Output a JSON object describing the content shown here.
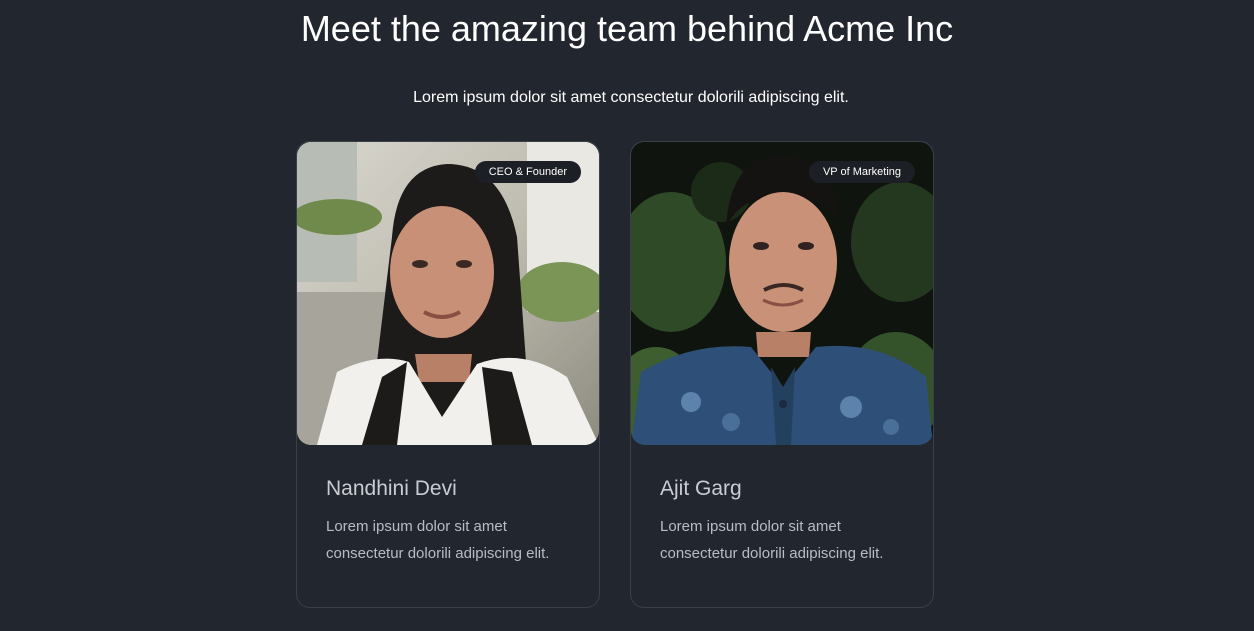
{
  "heading": {
    "title": "Meet the amazing team behind Acme Inc",
    "subtitle": "Lorem ipsum dolor sit amet consectetur dolorili adipiscing elit."
  },
  "team": [
    {
      "role": "CEO & Founder",
      "name": "Nandhini Devi",
      "bio": "Lorem ipsum dolor sit amet consectetur dolorili adipiscing elit.",
      "photo_icon": "portrait-photo"
    },
    {
      "role": "VP of Marketing",
      "name": "Ajit Garg",
      "bio": "Lorem ipsum dolor sit amet consectetur dolorili adipiscing elit.",
      "photo_icon": "portrait-photo"
    }
  ],
  "colors": {
    "background": "#22262e",
    "card_border": "#3a3f48",
    "badge_background": "#1c1f25",
    "text_primary": "#ffffff",
    "text_muted": "#b9bcc3"
  }
}
